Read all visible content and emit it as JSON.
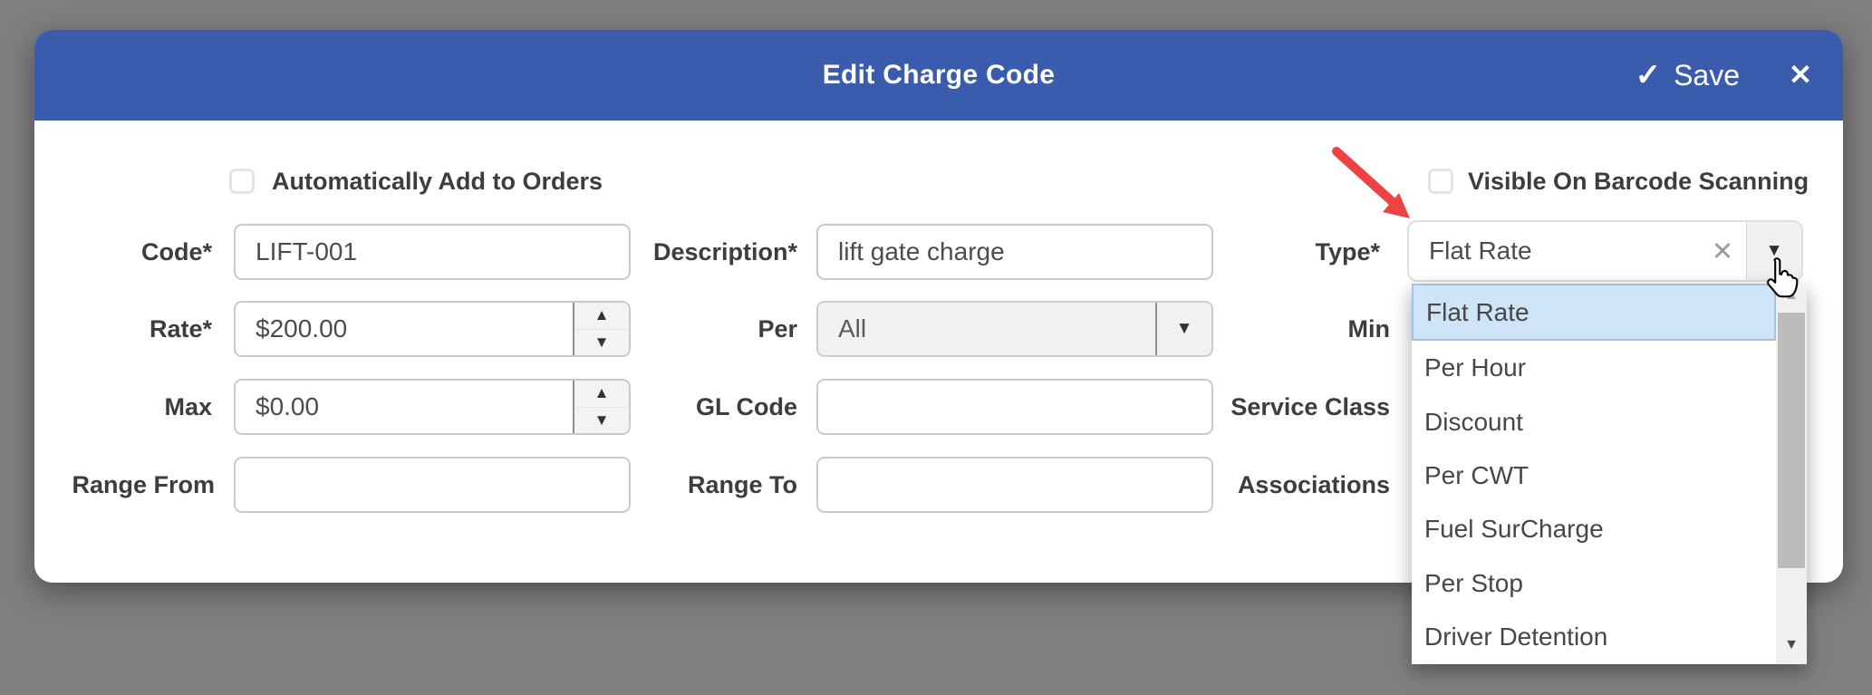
{
  "header": {
    "title": "Edit Charge Code",
    "save_label": "Save",
    "save_icon": "✓",
    "close_icon": "✕",
    "bg_color": "#3b5cad"
  },
  "checkboxes": {
    "auto_add_label": "Automatically Add to Orders",
    "auto_add_checked": false,
    "barcode_label": "Visible On Barcode Scanning",
    "barcode_checked": false
  },
  "fields": {
    "code": {
      "label": "Code*",
      "value": "LIFT-001"
    },
    "description": {
      "label": "Description*",
      "value": "lift gate charge"
    },
    "type": {
      "label": "Type*",
      "value": "Flat Rate"
    },
    "rate": {
      "label": "Rate*",
      "value": "$200.00"
    },
    "per": {
      "label": "Per",
      "value": "All"
    },
    "min": {
      "label": "Min"
    },
    "max": {
      "label": "Max",
      "value": "$0.00"
    },
    "gl_code": {
      "label": "GL Code",
      "value": ""
    },
    "service_class": {
      "label": "Service Class"
    },
    "range_from": {
      "label": "Range From",
      "value": ""
    },
    "range_to": {
      "label": "Range To",
      "value": ""
    },
    "associations": {
      "label": "Associations"
    }
  },
  "type_dropdown": {
    "selected": "Flat Rate",
    "selected_index": 0,
    "highlight_color": "#cfe4f6",
    "options": [
      "Flat Rate",
      "Per Hour",
      "Discount",
      "Per CWT",
      "Fuel SurCharge",
      "Per Stop",
      "Driver Detention"
    ]
  },
  "icons": {
    "clear": "✕",
    "caret_down": "▼",
    "spinner_up": "▲",
    "spinner_down": "▼",
    "scroll_up": "▲",
    "scroll_down": "▼"
  },
  "annotation": {
    "arrow_color": "#ee4343"
  }
}
